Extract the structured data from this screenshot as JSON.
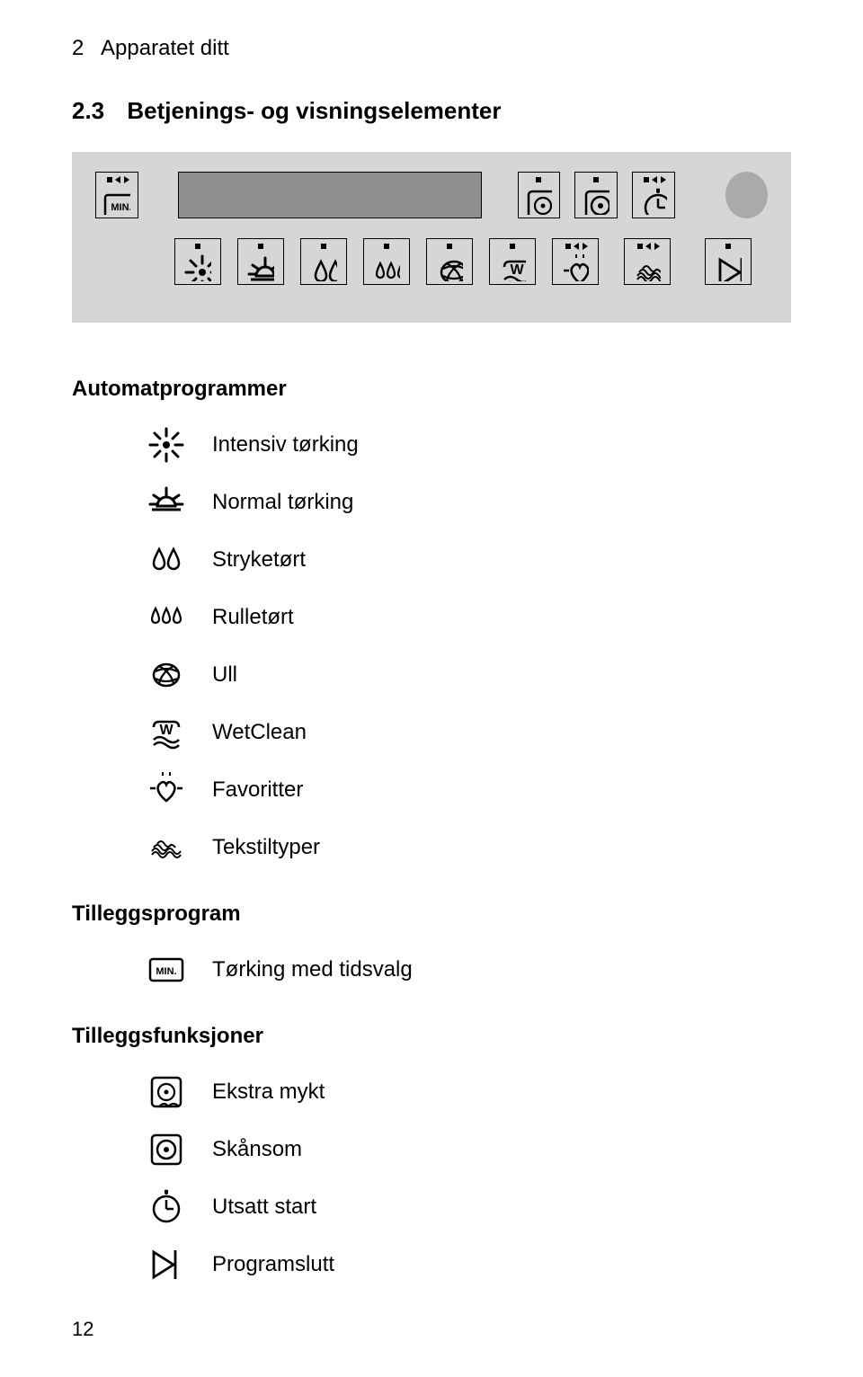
{
  "header": {
    "chapter_num": "2",
    "chapter_title": "Apparatet ditt"
  },
  "section": {
    "num": "2.3",
    "title": "Betjenings- og visningselementer"
  },
  "automat": {
    "heading": "Automatprogrammer",
    "items": [
      "Intensiv tørking",
      "Normal tørking",
      "Stryketørt",
      "Rulletørt",
      "Ull",
      "WetClean",
      "Favoritter",
      "Tekstiltyper"
    ]
  },
  "tilleggsprogram": {
    "heading": "Tilleggsprogram",
    "items": [
      "Tørking med tidsvalg"
    ]
  },
  "tilleggsfunksjoner": {
    "heading": "Tilleggsfunksjoner",
    "items": [
      "Ekstra mykt",
      "Skånsom",
      "Utsatt start",
      "Programslutt"
    ]
  },
  "page_number": "12"
}
